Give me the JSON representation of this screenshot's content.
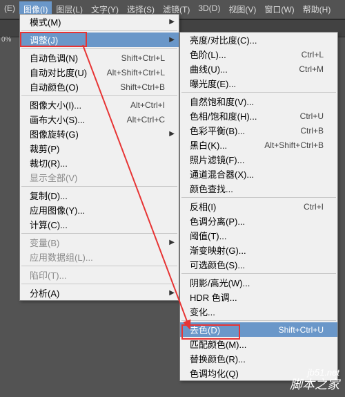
{
  "menubar": {
    "items": [
      {
        "label": "(E)"
      },
      {
        "label": "图像(I)",
        "active": true
      },
      {
        "label": "图层(L)"
      },
      {
        "label": "文字(Y)"
      },
      {
        "label": "选择(S)"
      },
      {
        "label": "滤镜(T)"
      },
      {
        "label": "3D(D)"
      },
      {
        "label": "视图(V)"
      },
      {
        "label": "窗口(W)"
      },
      {
        "label": "帮助(H)"
      }
    ]
  },
  "left_strip": "0%",
  "menu1": {
    "groups": [
      [
        {
          "label": "模式(M)",
          "arrow": true
        }
      ],
      [
        {
          "label": "调整(J)",
          "arrow": true,
          "highlight": true
        }
      ],
      [
        {
          "label": "自动色调(N)",
          "shortcut": "Shift+Ctrl+L"
        },
        {
          "label": "自动对比度(U)",
          "shortcut": "Alt+Shift+Ctrl+L"
        },
        {
          "label": "自动颜色(O)",
          "shortcut": "Shift+Ctrl+B"
        }
      ],
      [
        {
          "label": "图像大小(I)...",
          "shortcut": "Alt+Ctrl+I"
        },
        {
          "label": "画布大小(S)...",
          "shortcut": "Alt+Ctrl+C"
        },
        {
          "label": "图像旋转(G)",
          "arrow": true
        },
        {
          "label": "裁剪(P)"
        },
        {
          "label": "裁切(R)..."
        },
        {
          "label": "显示全部(V)",
          "disabled": true
        }
      ],
      [
        {
          "label": "复制(D)..."
        },
        {
          "label": "应用图像(Y)..."
        },
        {
          "label": "计算(C)..."
        }
      ],
      [
        {
          "label": "变量(B)",
          "arrow": true,
          "disabled": true
        },
        {
          "label": "应用数据组(L)...",
          "disabled": true
        }
      ],
      [
        {
          "label": "陷印(T)...",
          "disabled": true
        }
      ],
      [
        {
          "label": "分析(A)",
          "arrow": true
        }
      ]
    ]
  },
  "menu2": {
    "groups": [
      [
        {
          "label": "亮度/对比度(C)..."
        },
        {
          "label": "色阶(L)...",
          "shortcut": "Ctrl+L"
        },
        {
          "label": "曲线(U)...",
          "shortcut": "Ctrl+M"
        },
        {
          "label": "曝光度(E)..."
        }
      ],
      [
        {
          "label": "自然饱和度(V)..."
        },
        {
          "label": "色相/饱和度(H)...",
          "shortcut": "Ctrl+U"
        },
        {
          "label": "色彩平衡(B)...",
          "shortcut": "Ctrl+B"
        },
        {
          "label": "黑白(K)...",
          "shortcut": "Alt+Shift+Ctrl+B"
        },
        {
          "label": "照片滤镜(F)..."
        },
        {
          "label": "通道混合器(X)..."
        },
        {
          "label": "颜色查找..."
        }
      ],
      [
        {
          "label": "反相(I)",
          "shortcut": "Ctrl+I"
        },
        {
          "label": "色调分离(P)..."
        },
        {
          "label": "阈值(T)..."
        },
        {
          "label": "渐变映射(G)..."
        },
        {
          "label": "可选颜色(S)..."
        }
      ],
      [
        {
          "label": "阴影/高光(W)..."
        },
        {
          "label": "HDR 色调..."
        },
        {
          "label": "变化..."
        }
      ],
      [
        {
          "label": "去色(D)",
          "shortcut": "Shift+Ctrl+U",
          "highlight": true
        },
        {
          "label": "匹配颜色(M)..."
        },
        {
          "label": "替换颜色(R)..."
        },
        {
          "label": "色调均化(Q)"
        }
      ]
    ]
  },
  "watermark": {
    "line1": "jb51.net",
    "line2": "脚本之家"
  }
}
